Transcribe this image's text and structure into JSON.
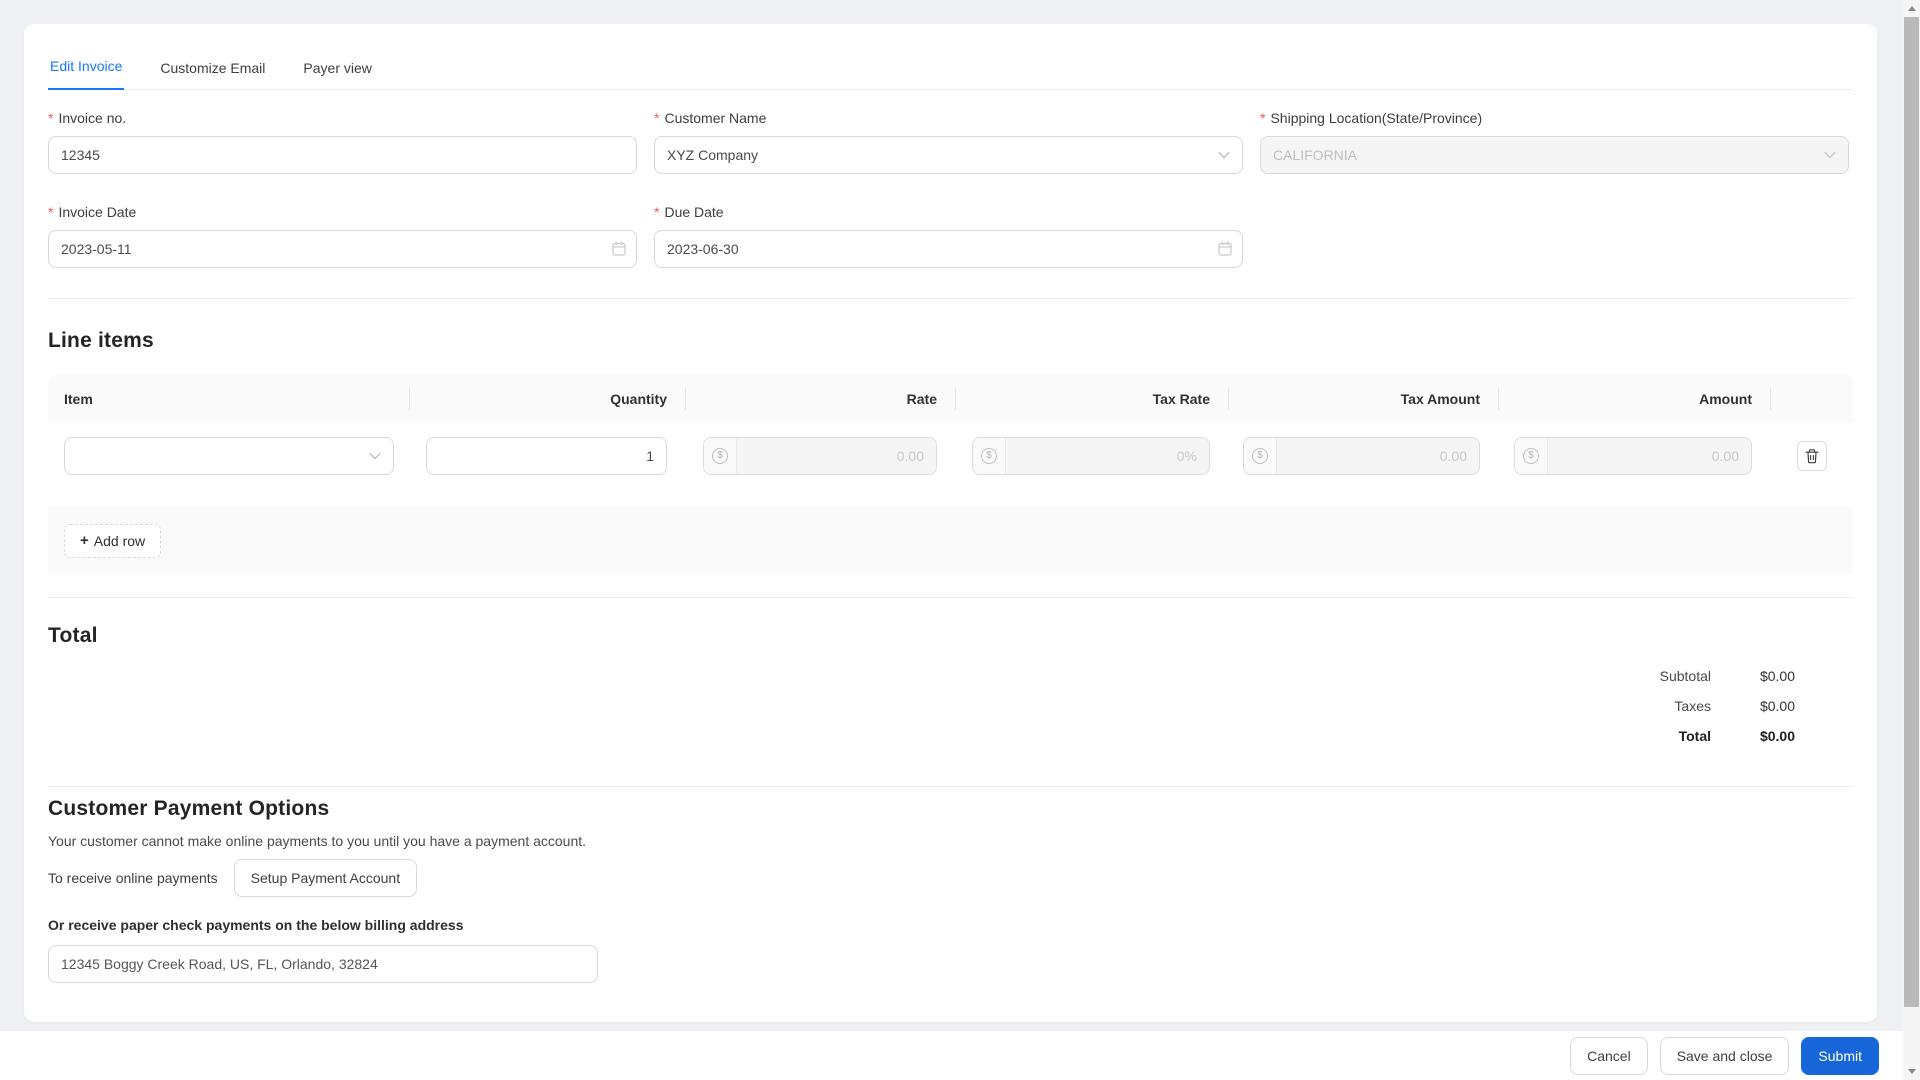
{
  "required_mark": "*",
  "icons": {
    "dollar": "$",
    "plus": "+"
  },
  "tabs": [
    {
      "label": "Edit Invoice",
      "active": true
    },
    {
      "label": "Customize Email",
      "active": false
    },
    {
      "label": "Payer view",
      "active": false
    }
  ],
  "form": {
    "invoice_no": {
      "label": "Invoice no.",
      "value": "12345"
    },
    "customer_name": {
      "label": "Customer Name",
      "value": "XYZ Company"
    },
    "shipping_location": {
      "label": "Shipping Location(State/Province)",
      "value": "CALIFORNIA",
      "disabled": true
    },
    "invoice_date": {
      "label": "Invoice Date",
      "value": "2023-05-11"
    },
    "due_date": {
      "label": "Due Date",
      "value": "2023-06-30"
    }
  },
  "line_items": {
    "title": "Line items",
    "columns": [
      "Item",
      "Quantity",
      "Rate",
      "Tax Rate",
      "Tax Amount",
      "Amount"
    ],
    "row": {
      "item": "",
      "quantity": "1",
      "rate_placeholder": "0.00",
      "tax_rate_placeholder": "0%",
      "tax_amount_placeholder": "0.00",
      "amount_placeholder": "0.00"
    },
    "add_row_label": "Add row"
  },
  "total": {
    "title": "Total",
    "rows": [
      {
        "label": "Subtotal",
        "value": "$0.00"
      },
      {
        "label": "Taxes",
        "value": "$0.00"
      },
      {
        "label": "Total",
        "value": "$0.00"
      }
    ]
  },
  "payment": {
    "title": "Customer Payment Options",
    "note": "Your customer cannot make online payments to you until you have a payment account.",
    "receive_text": "To receive online payments",
    "setup_button": "Setup Payment Account",
    "check_text": "Or receive paper check payments on the below billing address",
    "billing_address": "12345 Boggy Creek Road, US, FL, Orlando, 32824"
  },
  "footer": {
    "cancel": "Cancel",
    "save_close": "Save and close",
    "submit": "Submit"
  },
  "colors": {
    "accent": "#1677ff",
    "submit": "#1766d9",
    "required": "#ee5b5b"
  }
}
